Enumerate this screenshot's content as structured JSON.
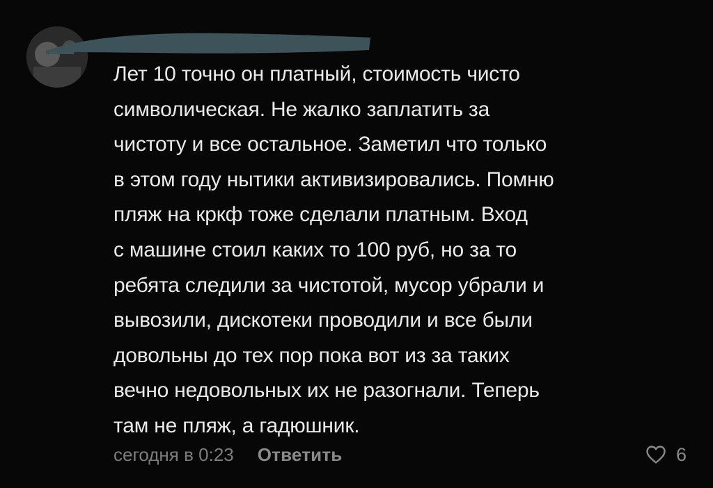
{
  "comment": {
    "text": "Лет 10 точно он платный, стоимость чисто\nсимволическая.  Не жалко заплатить за\nчистоту и все остальное. Заметил что только\nв этом году нытики активизировались. Помню\nпляж на кркф тоже сделали платным. Вход\nс машине стоил каких то 100 руб, но за то\nребята следили за чистотой, мусор убрали и\nвывозили, дискотеки проводили и все были\nдовольны до тех пор пока вот из за таких\nвечно недовольных их не разогнали. Теперь\nтам не пляж, а гадюшник.",
    "timestamp": "сегодня в 0:23",
    "reply_label": "Ответить",
    "like_count": "6",
    "like_icon": "heart-outline-icon"
  },
  "colors": {
    "background": "#070707",
    "text": "#e9e9e9",
    "meta": "#7d7d7d",
    "redaction": "#3d5259"
  }
}
